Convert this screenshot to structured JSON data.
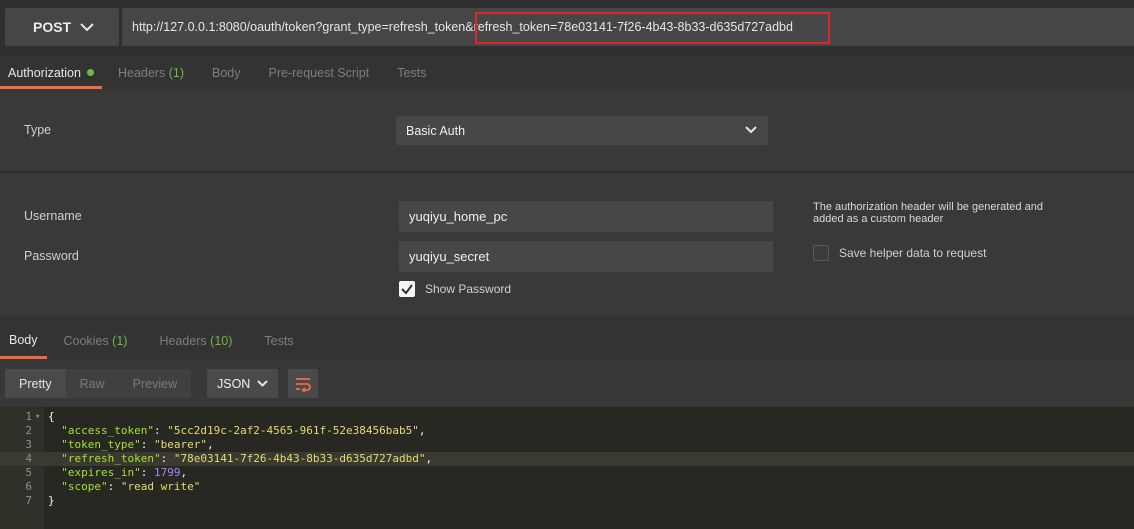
{
  "request": {
    "method": "POST",
    "url": "http://127.0.0.1:8080/oauth/token?grant_type=refresh_token&refresh_token=78e03141-7f26-4b43-8b33-d635d727adbd"
  },
  "request_tabs": [
    {
      "label": "Authorization",
      "count": ""
    },
    {
      "label": "Headers",
      "count": "(1)"
    },
    {
      "label": "Body",
      "count": ""
    },
    {
      "label": "Pre-request Script",
      "count": ""
    },
    {
      "label": "Tests",
      "count": ""
    }
  ],
  "auth": {
    "type_label": "Type",
    "type_value": "Basic Auth",
    "username_label": "Username",
    "username_value": "yuqiyu_home_pc",
    "password_label": "Password",
    "password_value": "yuqiyu_secret",
    "show_password_label": "Show Password",
    "note": "The authorization header will be generated and added as a custom header",
    "save_helper_label": "Save helper data to request"
  },
  "response_tabs": [
    {
      "label": "Body",
      "count": ""
    },
    {
      "label": "Cookies",
      "count": "(1)"
    },
    {
      "label": "Headers",
      "count": "(10)"
    },
    {
      "label": "Tests",
      "count": ""
    }
  ],
  "view_modes": [
    "Pretty",
    "Raw",
    "Preview"
  ],
  "format": "JSON",
  "response_body": {
    "line_numbers": [
      "1",
      "2",
      "3",
      "4",
      "5",
      "6",
      "7"
    ],
    "open_brace": "{",
    "close_brace": "}",
    "fields": [
      {
        "key": "\"access_token\"",
        "value": "\"5cc2d19c-2af2-4565-961f-52e38456bab5\"",
        "sep": ","
      },
      {
        "key": "\"token_type\"",
        "value": "\"bearer\"",
        "sep": ","
      },
      {
        "key": "\"refresh_token\"",
        "value": "\"78e03141-7f26-4b43-8b33-d635d727adbd\"",
        "sep": ","
      },
      {
        "key": "\"expires_in\"",
        "value": "1799",
        "sep": ","
      },
      {
        "key": "\"scope\"",
        "value": "\"read write\"",
        "sep": ""
      }
    ]
  },
  "colors": {
    "accent": "#f26b3a",
    "ok_green": "#73b548",
    "highlight_box": "#e0262b"
  }
}
